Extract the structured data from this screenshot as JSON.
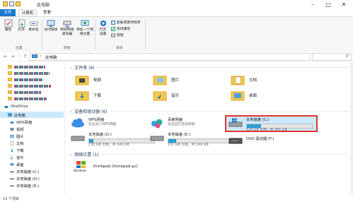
{
  "window": {
    "title": "此电脑"
  },
  "ribbon_tabs": {
    "file": "文件",
    "computer": "计算机",
    "view": "查看"
  },
  "ribbon": {
    "properties": "属性",
    "open": "打开",
    "rename": "重命名",
    "media_access": "访问媒体",
    "map_drive": "映射网络驱动器",
    "add_location": "添加一个网络位置",
    "open_settings": "打开设置",
    "uninstall": "卸载或更改程序",
    "sys_props": "系统属性",
    "manage": "管理",
    "group_location": "位置",
    "group_network": "网络",
    "group_system": "系统"
  },
  "address": {
    "crumb": "此电脑"
  },
  "sidebar": {
    "onedrive": "OneDrive",
    "this_pc": "此电脑",
    "items": [
      "WPS网盘",
      "视频",
      "图片",
      "文档",
      "下载",
      "音乐",
      "桌面",
      "本地磁盘 (C:)",
      "本地磁盘 (D:)",
      "本地磁盘 (E:)"
    ]
  },
  "sections": {
    "folders": "文件夹 (6)",
    "drives": "设备和驱动器 (6)",
    "network": "网络位置 (1)"
  },
  "folders": [
    "视频",
    "图片",
    "文档",
    "下载",
    "音乐",
    "桌面"
  ],
  "drives": {
    "wps": {
      "name": "WPS网盘",
      "sub": "双击进入WPS网盘"
    },
    "baidu": {
      "name": "百度网盘",
      "sub": "双击运行百度网盘"
    },
    "c": {
      "name": "本地磁盘 (C:)",
      "size": "128 GB 可用，共 165 GB",
      "used": 0.22
    },
    "d": {
      "name": "本地磁盘 (D:)",
      "size": "138 GB 可用，共 149 GB",
      "used": 0.07
    },
    "e": {
      "name": "本地磁盘 (E:)",
      "size": "131 GB 可用，共 149 GB",
      "used": 0.12
    },
    "dvd": {
      "name": "DVD 驱动器 (F:)"
    }
  },
  "network_location": {
    "name": "thinkpad (thinkpad-pc)",
    "icon_label": "Windows"
  },
  "status": {
    "count": "13 个项目"
  }
}
